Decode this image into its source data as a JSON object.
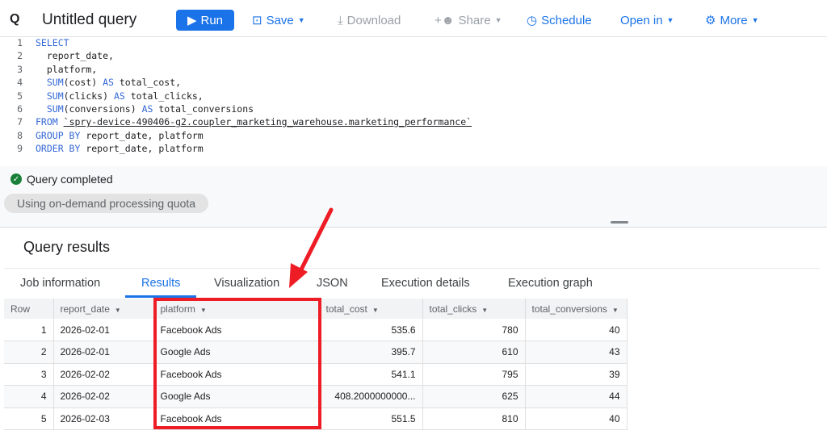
{
  "toolbar": {
    "title": "Untitled query",
    "run": "Run",
    "save": "Save",
    "download": "Download",
    "share": "Share",
    "schedule": "Schedule",
    "open_in": "Open in",
    "more": "More"
  },
  "editor": {
    "lines": [
      {
        "n": "1",
        "parts": [
          [
            "kw",
            "SELECT"
          ]
        ]
      },
      {
        "n": "2",
        "parts": [
          [
            "",
            "  report_date,"
          ]
        ]
      },
      {
        "n": "3",
        "parts": [
          [
            "",
            "  platform,"
          ]
        ]
      },
      {
        "n": "4",
        "parts": [
          [
            "kw",
            "  SUM"
          ],
          [
            "",
            "(cost) "
          ],
          [
            "kw",
            "AS"
          ],
          [
            "",
            " total_cost,"
          ]
        ]
      },
      {
        "n": "5",
        "parts": [
          [
            "kw",
            "  SUM"
          ],
          [
            "",
            "(clicks) "
          ],
          [
            "kw",
            "AS"
          ],
          [
            "",
            " total_clicks,"
          ]
        ]
      },
      {
        "n": "6",
        "parts": [
          [
            "kw",
            "  SUM"
          ],
          [
            "",
            "(conversions) "
          ],
          [
            "kw",
            "AS"
          ],
          [
            "",
            " total_conversions"
          ]
        ]
      },
      {
        "n": "7",
        "parts": [
          [
            "kw",
            "FROM"
          ],
          [
            "",
            " "
          ],
          [
            "tbl",
            "`spry-device-490406-g2.coupler_marketing_warehouse.marketing_performance`"
          ]
        ]
      },
      {
        "n": "8",
        "parts": [
          [
            "kw",
            "GROUP BY"
          ],
          [
            "",
            " report_date, platform"
          ]
        ]
      },
      {
        "n": "9",
        "parts": [
          [
            "kw",
            "ORDER BY"
          ],
          [
            "",
            " report_date, platform"
          ]
        ]
      }
    ]
  },
  "status": {
    "message": "Query completed",
    "quota": "Using on-demand processing quota"
  },
  "results": {
    "title": "Query results",
    "tabs": [
      "Job information",
      "Results",
      "Visualization",
      "JSON",
      "Execution details",
      "Execution graph"
    ],
    "active_tab": "Results",
    "columns": [
      "Row",
      "report_date",
      "platform",
      "total_cost",
      "total_clicks",
      "total_conversions"
    ],
    "rows": [
      [
        "1",
        "2026-02-01",
        "Facebook Ads",
        "535.6",
        "780",
        "40"
      ],
      [
        "2",
        "2026-02-01",
        "Google Ads",
        "395.7",
        "610",
        "43"
      ],
      [
        "3",
        "2026-02-02",
        "Facebook Ads",
        "541.1",
        "795",
        "39"
      ],
      [
        "4",
        "2026-02-02",
        "Google Ads",
        "408.2000000000...",
        "625",
        "44"
      ],
      [
        "5",
        "2026-02-03",
        "Facebook Ads",
        "551.5",
        "810",
        "40"
      ]
    ]
  },
  "annotation": {
    "color": "#ee1c24"
  }
}
